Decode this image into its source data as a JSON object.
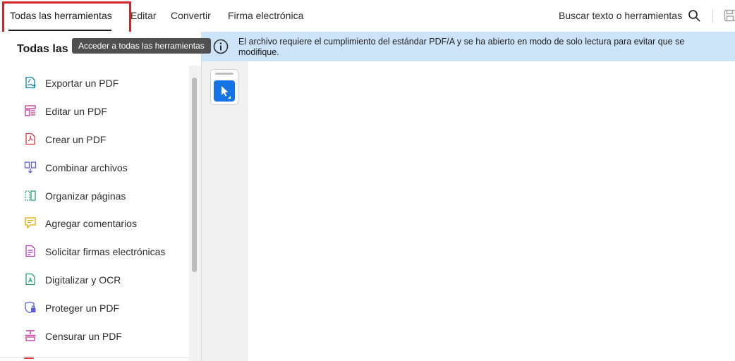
{
  "topbar": {
    "tabs": [
      {
        "label": "Todas las herramientas"
      },
      {
        "label": "Editar"
      },
      {
        "label": "Convertir"
      },
      {
        "label": "Firma electrónica"
      }
    ],
    "search_label": "Buscar texto o herramientas",
    "search_icon": "search-icon",
    "save_icon": "save-icon"
  },
  "tooltip": {
    "text": "Acceder a todas las herramientas"
  },
  "left_panel": {
    "title": "Todas las",
    "tools": [
      {
        "label": "Exportar un PDF",
        "icon": "export-pdf-icon",
        "color": "#0d86a4"
      },
      {
        "label": "Editar un PDF",
        "icon": "edit-pdf-icon",
        "color": "#c2349b"
      },
      {
        "label": "Crear un PDF",
        "icon": "create-pdf-icon",
        "color": "#d7373f"
      },
      {
        "label": "Combinar archivos",
        "icon": "combine-files-icon",
        "color": "#5c5ce0"
      },
      {
        "label": "Organizar páginas",
        "icon": "organize-pages-icon",
        "color": "#2d9d78"
      },
      {
        "label": "Agregar comentarios",
        "icon": "add-comment-icon",
        "color": "#e6a700"
      },
      {
        "label": "Solicitar firmas electrónicas",
        "icon": "request-signatures-icon",
        "color": "#b33bb3"
      },
      {
        "label": "Digitalizar y OCR",
        "icon": "scan-ocr-icon",
        "color": "#2d9d78"
      },
      {
        "label": "Proteger un PDF",
        "icon": "protect-pdf-icon",
        "color": "#5c5ce0"
      },
      {
        "label": "Censurar un PDF",
        "icon": "redact-pdf-icon",
        "color": "#c2349b"
      }
    ]
  },
  "info_banner": {
    "line1": "El archivo requiere el cumplimiento del estándar PDF/A y se ha abierto en modo de solo lectura para evitar que se",
    "line2": "modifique.",
    "icon": "info-icon",
    "background": "#cde3f8"
  },
  "toolbar": {
    "select_tool_icon": "selection-cursor-icon",
    "accent": "#1473e6"
  }
}
